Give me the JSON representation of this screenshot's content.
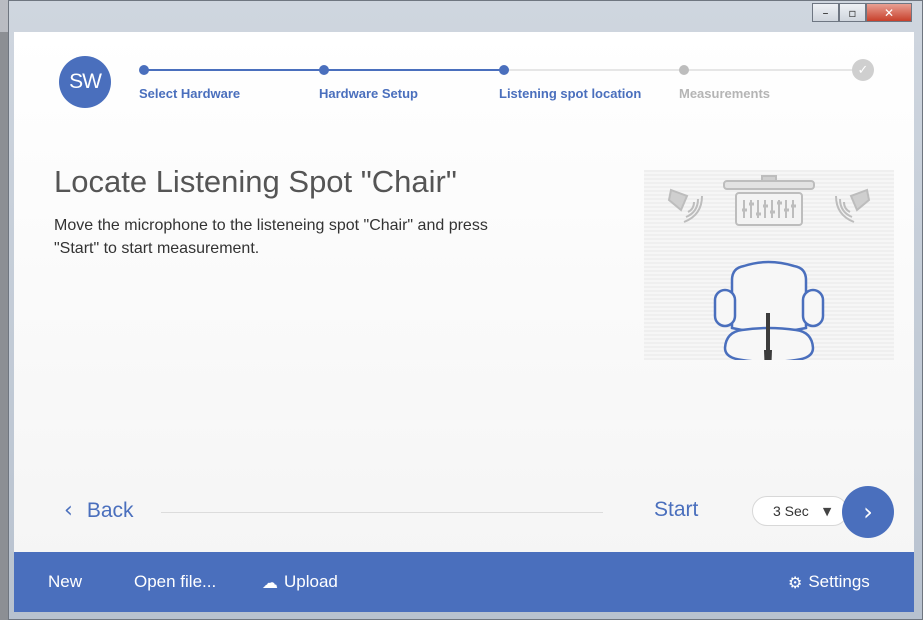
{
  "window": {
    "controls": {
      "minimize": "–",
      "maximize": "▫",
      "close": "✕"
    }
  },
  "app": {
    "logo_text": "SW",
    "accent": "#4a6fbd",
    "inactive": "#c4c4c4"
  },
  "steps": [
    {
      "label": "Select Hardware",
      "state": "done"
    },
    {
      "label": "Hardware Setup",
      "state": "done"
    },
    {
      "label": "Listening spot location",
      "state": "current"
    },
    {
      "label": "Measurements",
      "state": "pending"
    }
  ],
  "final_step_icon": "check-icon",
  "main": {
    "title": "Locate Listening Spot \"Chair\"",
    "description": "Move the microphone to the listeneing spot \"Chair\" and press \"Start\" to start measurement."
  },
  "nav": {
    "back_label": "Back",
    "start_label": "Start",
    "delay_value": "3 Sec",
    "next_icon": "chevron-right-icon"
  },
  "footer": {
    "new_label": "New",
    "open_label": "Open file...",
    "upload_label": "Upload",
    "settings_label": "Settings"
  }
}
